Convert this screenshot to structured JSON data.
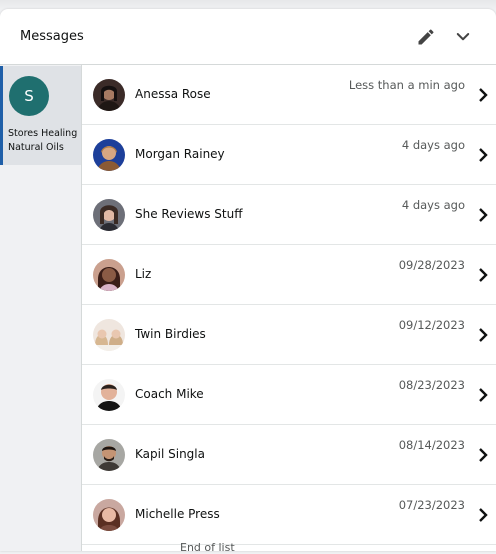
{
  "header": {
    "title": "Messages",
    "edit_icon": "pencil-icon",
    "collapse_icon": "chevron-down-icon"
  },
  "sidebar": {
    "stores": [
      {
        "initial": "S",
        "name": "Stores Healing Natural Oils"
      }
    ]
  },
  "conversations": [
    {
      "name": "Anessa Rose",
      "time": "Less than a min ago"
    },
    {
      "name": "Morgan Rainey",
      "time": "4 days ago"
    },
    {
      "name": "She Reviews Stuff",
      "time": "4 days ago"
    },
    {
      "name": "Liz",
      "time": "09/28/2023"
    },
    {
      "name": "Twin Birdies",
      "time": "09/12/2023"
    },
    {
      "name": "Coach Mike",
      "time": "08/23/2023"
    },
    {
      "name": "Kapil Singla",
      "time": "08/14/2023"
    },
    {
      "name": "Michelle Press",
      "time": "07/23/2023"
    }
  ],
  "footer": {
    "end_text": "End of list"
  }
}
